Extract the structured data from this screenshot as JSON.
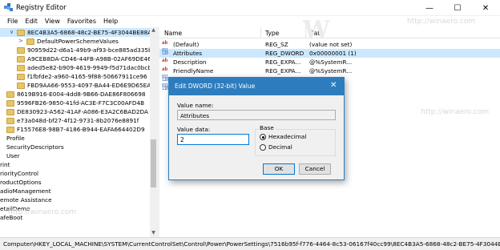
{
  "window": {
    "title": "Registry Editor",
    "controls": {
      "minimize": "—",
      "maximize": "☐",
      "close": "✕"
    }
  },
  "menu": [
    "File",
    "Edit",
    "View",
    "Favorites",
    "Help"
  ],
  "tree": {
    "items": [
      {
        "label": "8EC4B3A5-6868-48c2-BE75-4F3044BE88A7",
        "selected": true,
        "expanded": true
      },
      {
        "label": "DefaultPowerSchemeValues",
        "expander": ">"
      },
      {
        "label": "90959d22-d6a1-49b9-af93-bce885ad335b"
      },
      {
        "label": "A9CEB8DA-CD46-44FB-A98B-02AF69DE4623"
      },
      {
        "label": "aded5e82-b909-4619-9949-f5d71dac0bcb"
      },
      {
        "label": "f1fbfde2-a960-4165-9f88-50667911ce96"
      },
      {
        "label": "FBD9AA66-9553-4097-BA44-ED6E9D65EAB8"
      },
      {
        "label": "8619B916-E004-4dd8-9B66-DAE86F806698"
      },
      {
        "label": "9596FB26-9850-41fd-AC3E-F7C3C00AFD4B"
      },
      {
        "label": "DE830923-A562-41AF-A086-E3A2C6BAD2DA"
      },
      {
        "label": "e73a048d-bf27-4f12-9731-8b2076e8891f"
      },
      {
        "label": "F15576E8-98B7-4186-B944-EAFA664402D9"
      },
      {
        "label": "Profile"
      },
      {
        "label": "SecurityDescriptors"
      },
      {
        "label": "User"
      },
      {
        "label": "rint"
      },
      {
        "label": "riorityControl"
      },
      {
        "label": "roductOptions"
      },
      {
        "label": "adioManagement"
      },
      {
        "label": "emote Assistance"
      },
      {
        "label": "etailDemo"
      },
      {
        "label": "afeBoot"
      }
    ]
  },
  "list": {
    "columns": [
      "Name",
      "Type",
      "Data"
    ],
    "rows": [
      {
        "icon": "ab",
        "name": "(Default)",
        "type": "REG_SZ",
        "data": "(value not set)"
      },
      {
        "icon": "bin",
        "name": "Attributes",
        "type": "REG_DWORD",
        "data": "0x00000001 (1)",
        "selected": true
      },
      {
        "icon": "ab",
        "name": "Description",
        "type": "REG_EXPA...",
        "data": "@%SystemR..."
      },
      {
        "icon": "ab",
        "name": "FriendlyName",
        "type": "REG_EXPA...",
        "data": "@%SystemR..."
      }
    ]
  },
  "status": "Computer\\HKEY_LOCAL_MACHINE\\SYSTEM\\CurrentControlSet\\Control\\Power\\PowerSettings\\7516b95f-f776-4464-8c53-06167f40cc99\\8EC4B3A5-6868-48c2-BE75-4F3044BE88A7",
  "dialog": {
    "title": "Edit DWORD (32-bit) Value",
    "close": "✕",
    "value_name_label": "Value name:",
    "value_name": "Attributes",
    "value_data_label": "Value data:",
    "value_data": "2",
    "base_label": "Base",
    "base_options": [
      "Hexadecimal",
      "Decimal"
    ],
    "base_selected": "Hexadecimal",
    "ok": "OK",
    "cancel": "Cancel"
  },
  "watermark": {
    "text": "http://winaero.com",
    "logo": "W"
  },
  "colors": {
    "accent": "#2d7dbe",
    "selection": "#cce8ff",
    "folder": "#e8c468"
  }
}
